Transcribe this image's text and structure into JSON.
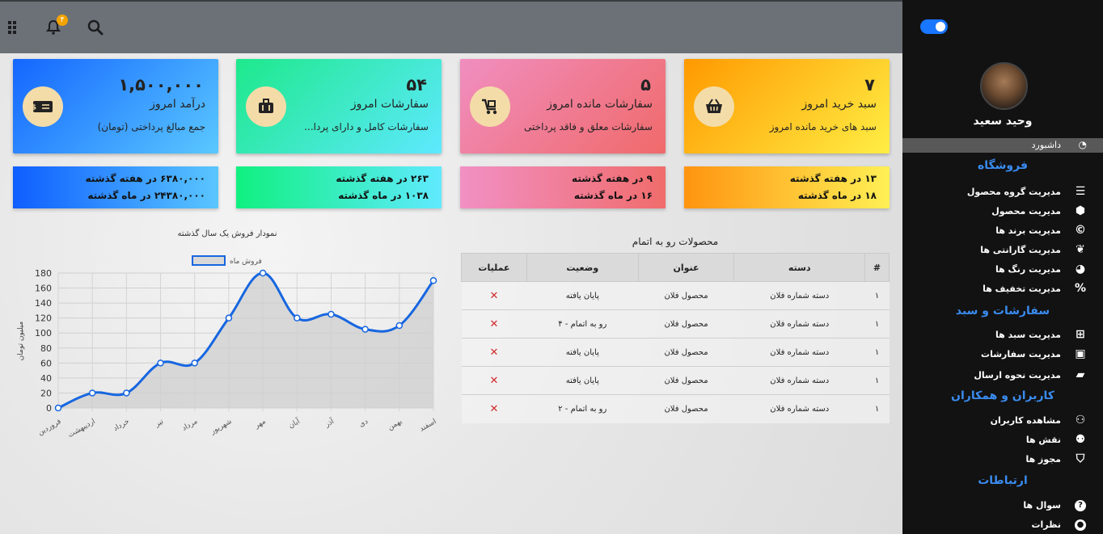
{
  "topbar": {
    "bell_badge": "۴"
  },
  "cards": [
    {
      "number": "۷",
      "title": "سبد خرید امروز",
      "subtitle": "سبد های خرید مانده امروز",
      "icon": "basket-icon"
    },
    {
      "number": "۵",
      "title": "سفارشات مانده امروز",
      "subtitle": "سفارشات معلق و فاقد پرداختی",
      "icon": "cart-icon"
    },
    {
      "number": "۵۴",
      "title": "سفارشات امروز",
      "subtitle": "سفارشات کامل و دارای پردا...",
      "icon": "luggage-icon"
    },
    {
      "number": "۱,۵۰۰,۰۰۰",
      "title": "درآمد امروز",
      "subtitle": "جمع مبالغ پرداختی (تومان)",
      "icon": "money-icon"
    }
  ],
  "stats": [
    {
      "line1": "۱۳ در هفته گذشته",
      "line2": "۱۸ در ماه گذشته"
    },
    {
      "line1": "۹ در هفته گذشته",
      "line2": "۱۶ در ماه گذشته"
    },
    {
      "line1": "۲۶۳ در هفته گذشته",
      "line2": "۱۰۳۸ در ماه گذشته"
    },
    {
      "line1": "۶۳۸۰,۰۰۰ در هفته گذشته",
      "line2": "۲۴۳۸۰,۰۰۰ در ماه گذشته"
    }
  ],
  "table": {
    "title": "محصولات رو به اتمام",
    "headers": [
      "#",
      "دسته",
      "عنوان",
      "وضعیت",
      "عملیات"
    ],
    "rows": [
      {
        "num": "۱",
        "category": "دسته شماره فلان",
        "title": "محصول فلان",
        "status": "پایان یافته",
        "action": "✕"
      },
      {
        "num": "۱",
        "category": "دسته شماره فلان",
        "title": "محصول فلان",
        "status": "رو به اتمام - ۴",
        "action": "✕"
      },
      {
        "num": "۱",
        "category": "دسته شماره فلان",
        "title": "محصول فلان",
        "status": "پایان یافته",
        "action": "✕"
      },
      {
        "num": "۱",
        "category": "دسته شماره فلان",
        "title": "محصول فلان",
        "status": "پایان یافته",
        "action": "✕"
      },
      {
        "num": "۱",
        "category": "دسته شماره فلان",
        "title": "محصول فلان",
        "status": "رو به اتمام - ۲",
        "action": "✕"
      }
    ]
  },
  "chart_data": {
    "type": "line",
    "title": "نمودار فروش یک سال گذشته",
    "ylabel": "میلیون تومان",
    "xlabel": "",
    "categories": [
      "فروردین",
      "اردیبهشت",
      "خرداد",
      "تیر",
      "مرداد",
      "شهریور",
      "مهر",
      "آبان",
      "آذر",
      "دی",
      "بهمن",
      "اسفند"
    ],
    "series": [
      {
        "name": "فروش ماه",
        "values": [
          0,
          20,
          20,
          60,
          60,
          120,
          180,
          120,
          125,
          105,
          110,
          170
        ]
      }
    ],
    "ylim": [
      0,
      180
    ],
    "yticks": [
      0,
      20,
      40,
      60,
      80,
      100,
      120,
      140,
      160,
      180
    ],
    "grid": true,
    "legend": "top-center",
    "colors": {
      "line": "#1766e0",
      "fill": "#cfcfcf"
    }
  },
  "sidebar": {
    "username": "وحید سعید",
    "dashboard": {
      "label": "داشبورد",
      "icon": "gauge-icon"
    },
    "sections": [
      {
        "title": "فروشگاه",
        "items": [
          {
            "label": "مدیریت گروه محصول",
            "icon": "list-icon"
          },
          {
            "label": "مدیریت محصول",
            "icon": "box-icon"
          },
          {
            "label": "مدیریت برند ها",
            "icon": "copyright-icon"
          },
          {
            "label": "مدیریت گارانتی ها",
            "icon": "leaf-icon"
          },
          {
            "label": "مدیریت رنگ ها",
            "icon": "palette-icon"
          },
          {
            "label": "مدیریت تخفیف ها",
            "icon": "percent-icon"
          }
        ]
      },
      {
        "title": "سفارشات و سبد",
        "items": [
          {
            "label": "مدیریت سبد ها",
            "icon": "basket-icon"
          },
          {
            "label": "مدیریت سفارشات",
            "icon": "luggage-icon"
          },
          {
            "label": "مدیریت نحوه ارسال",
            "icon": "truck-icon"
          }
        ]
      },
      {
        "title": "کاربران و همکاران",
        "items": [
          {
            "label": "مشاهده کاربران",
            "icon": "users-icon"
          },
          {
            "label": "نقش ها",
            "icon": "user-cog-icon"
          },
          {
            "label": "مجوز ها",
            "icon": "shield-icon"
          }
        ]
      },
      {
        "title": "ارتباطات",
        "items": [
          {
            "label": "سوال ها",
            "icon": "question-icon"
          },
          {
            "label": "نظرات",
            "icon": "comment-icon"
          }
        ]
      }
    ]
  }
}
